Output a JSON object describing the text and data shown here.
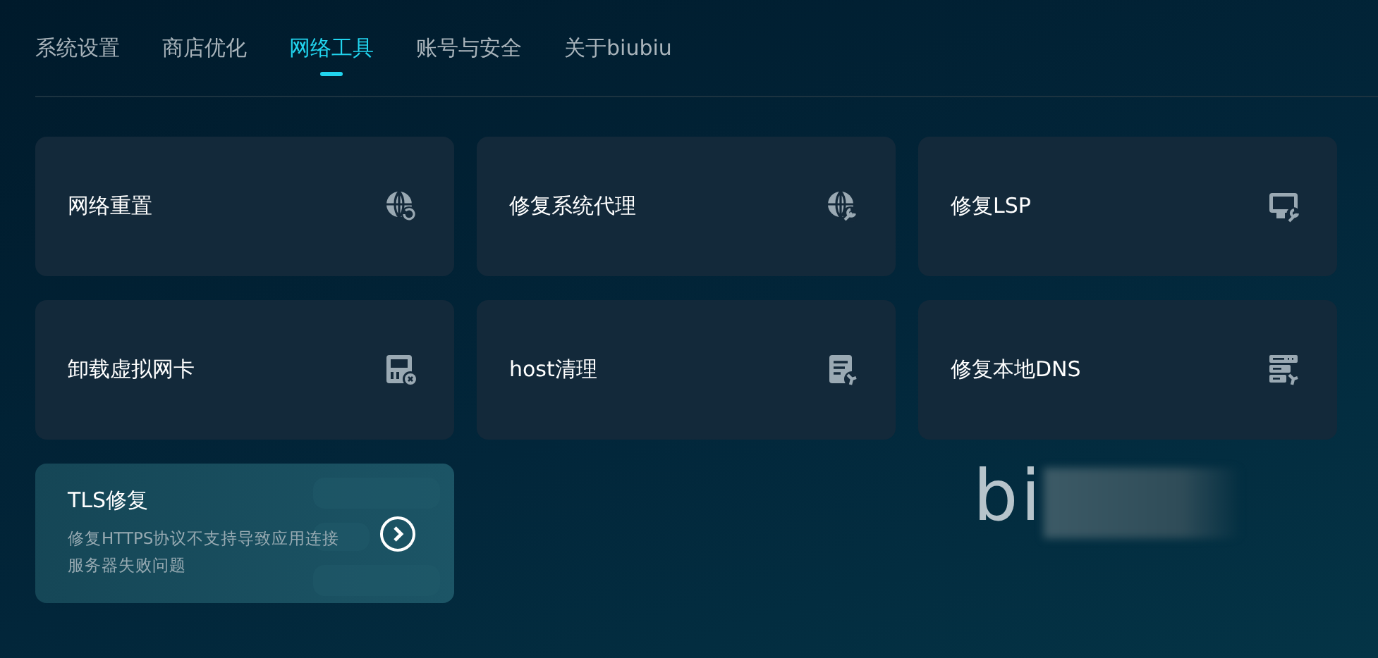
{
  "tabs": [
    {
      "label": "系统设置",
      "selected": false
    },
    {
      "label": "商店优化",
      "selected": false
    },
    {
      "label": "网络工具",
      "selected": true
    },
    {
      "label": "账号与安全",
      "selected": false
    },
    {
      "label": "关于biubiu",
      "selected": false
    }
  ],
  "tools": [
    {
      "kind": "tool",
      "title": "网络重置"
    },
    {
      "kind": "tool",
      "title": "修复系统代理"
    },
    {
      "kind": "tool",
      "title": "修复LSP"
    },
    {
      "kind": "tool",
      "title": "卸载虚拟网卡"
    },
    {
      "kind": "tool",
      "title": "host清理"
    },
    {
      "kind": "tool",
      "title": "修复本地DNS"
    },
    {
      "kind": "detail",
      "title": "TLS修复",
      "description": "修复HTTPS协议不支持导致应用连接服务器失败问题"
    }
  ],
  "logo": "bi"
}
